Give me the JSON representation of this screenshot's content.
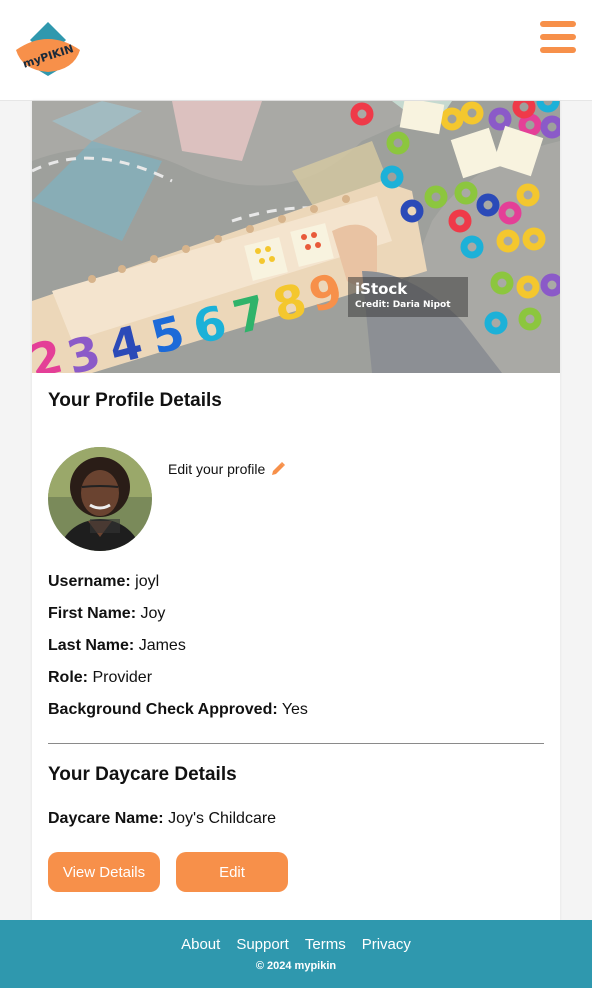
{
  "header": {
    "logo_text": "myPIKIN",
    "menu_icon": "hamburger-menu-icon",
    "brand_color": "#f7904a",
    "logo_teal": "#2f98ae"
  },
  "hero": {
    "watermark_brand": "iStock",
    "watermark_credit": "Credit: Daria Nipot",
    "puzzle_numbers": [
      "2",
      "3",
      "4",
      "5",
      "6",
      "7",
      "8",
      "9"
    ]
  },
  "profile": {
    "title": "Your Profile Details",
    "edit_label": "Edit your profile",
    "fields": [
      {
        "label": "Username:",
        "value": "joyl"
      },
      {
        "label": "First Name:",
        "value": "Joy"
      },
      {
        "label": "Last Name:",
        "value": "James"
      },
      {
        "label": "Role:",
        "value": "Provider"
      },
      {
        "label": "Background Check Approved:",
        "value": "Yes"
      }
    ]
  },
  "daycare": {
    "title": "Your Daycare Details",
    "name_label": "Daycare Name:",
    "name_value": "Joy's Childcare",
    "view_button": "View Details",
    "edit_button": "Edit"
  },
  "footer": {
    "links": [
      "About",
      "Support",
      "Terms",
      "Privacy"
    ],
    "copyright": "© 2024 mypikin",
    "background": "#2f98ae"
  }
}
